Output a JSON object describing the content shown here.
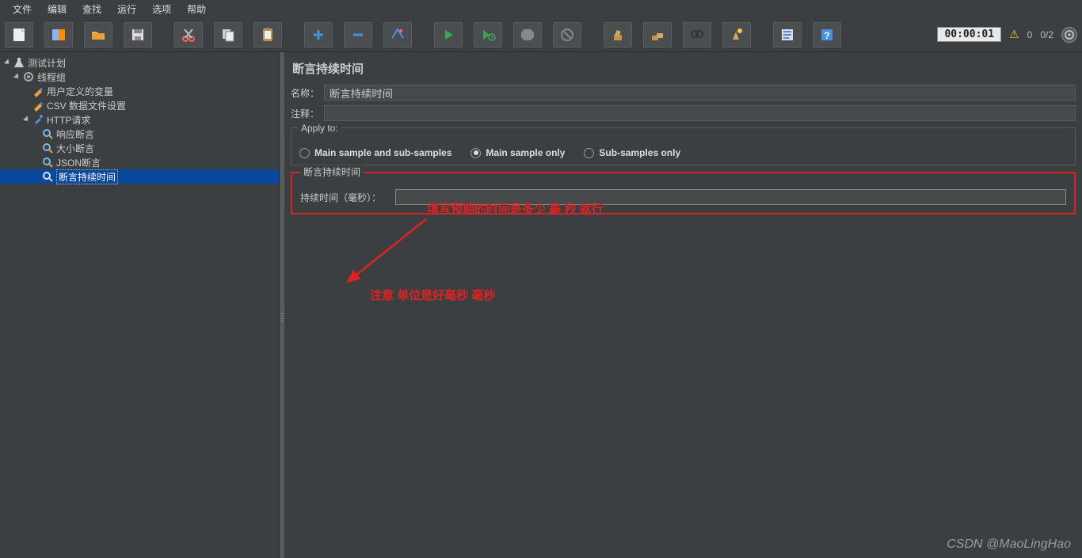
{
  "menu": {
    "file": "文件",
    "edit": "编辑",
    "find": "查找",
    "run": "运行",
    "options": "选项",
    "help": "帮助"
  },
  "toolbar_status": {
    "timer": "00:00:01",
    "warn_count": "0",
    "run_ratio": "0/2"
  },
  "tree": {
    "root": "测试计划",
    "thread_group": "线程组",
    "user_vars": "用户定义的变量",
    "csv": "CSV 数据文件设置",
    "http": "HTTP请求",
    "resp_assert": "响应断言",
    "size_assert": "大小断言",
    "json_assert": "JSON断言",
    "dur_assert": "断言持续时间"
  },
  "panel": {
    "title": "断言持续时间",
    "name_label": "名称：",
    "name_value": "断言持续时间",
    "comment_label": "注释：",
    "apply_legend": "Apply to:",
    "radio1": "Main sample and sub-samples",
    "radio2": "Main sample only",
    "radio3": "Sub-samples only",
    "duration_legend": "断言持续时间",
    "duration_label": "持续时间（毫秒）：",
    "annot1": "填写预期的时间是多少  毫 秒   就行",
    "annot2": "注意  单位是好毫秒   毫秒"
  },
  "watermark": "CSDN @MaoLingHao"
}
